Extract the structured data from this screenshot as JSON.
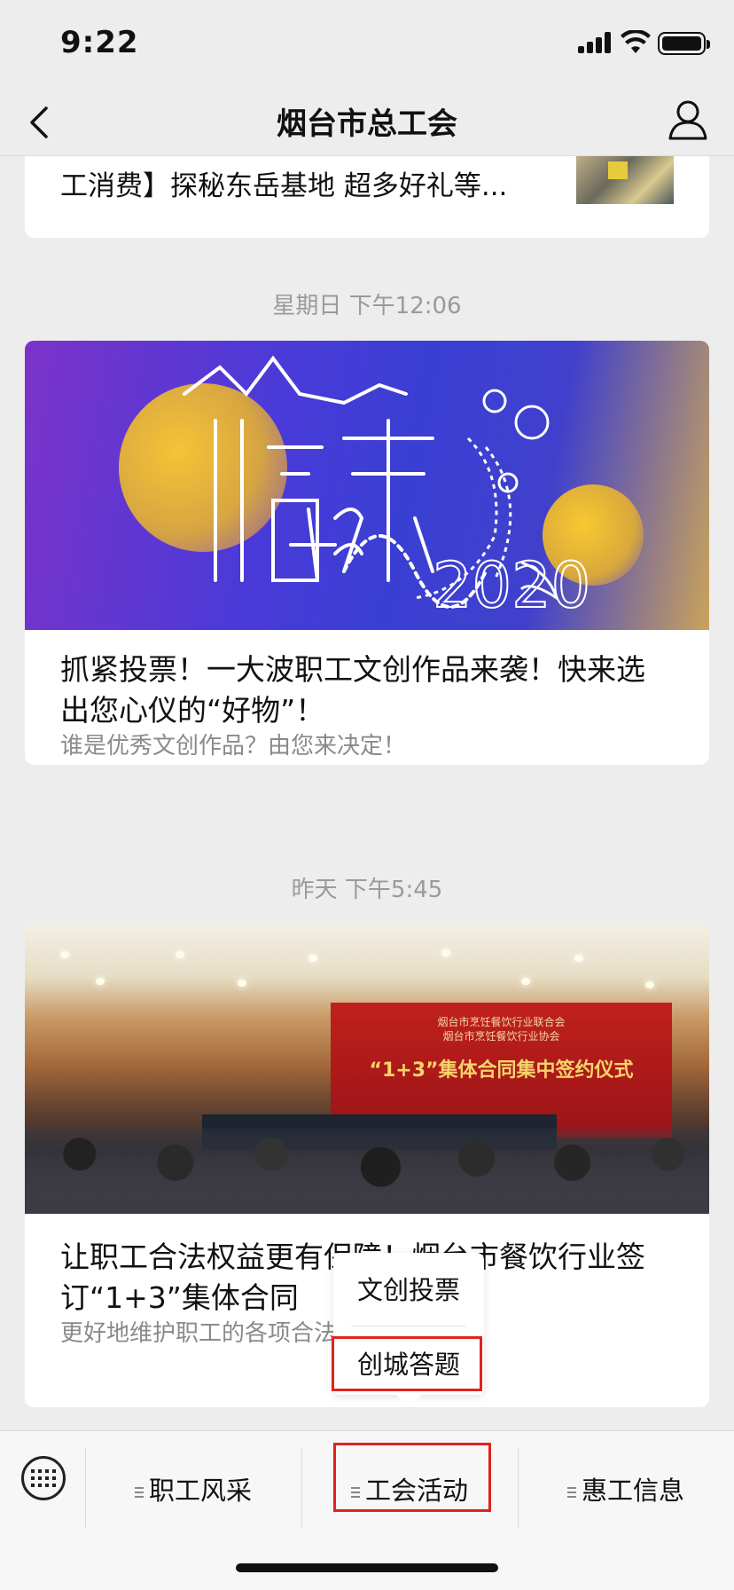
{
  "status": {
    "time": "9:22"
  },
  "nav": {
    "title": "烟台市总工会"
  },
  "feed": {
    "prev_item": {
      "title": "工消费】探秘东岳基地 超多好礼等..."
    },
    "items": [
      {
        "timestamp": "星期日 下午12:06",
        "title": "抓紧投票！一大波职工文创作品来袭！快来选出您心仪的“好物”！",
        "desc": "谁是优秀文创作品？由您来决定！",
        "cover_theme": "purple-gradient-artwork"
      },
      {
        "timestamp": "昨天 下午5:45",
        "title": "让职工合法权益更有保障！烟台市餐饮行业签订“1+3”集体合同",
        "desc": "更好地维护职工的各项合法权益",
        "cover_banner_main": "“1+3”集体合同集中签约仪式",
        "cover_banner_sub": "烟台市烹饪餐饮行业联合会\n烟台市烹饪餐饮行业协会"
      }
    ]
  },
  "submenu": {
    "items": [
      "文创投票",
      "创城答题"
    ]
  },
  "bottom_menu": {
    "items": [
      "职工风采",
      "工会活动",
      "惠工信息"
    ]
  },
  "colors": {
    "highlight": "#e0231d",
    "background": "#ededed"
  }
}
